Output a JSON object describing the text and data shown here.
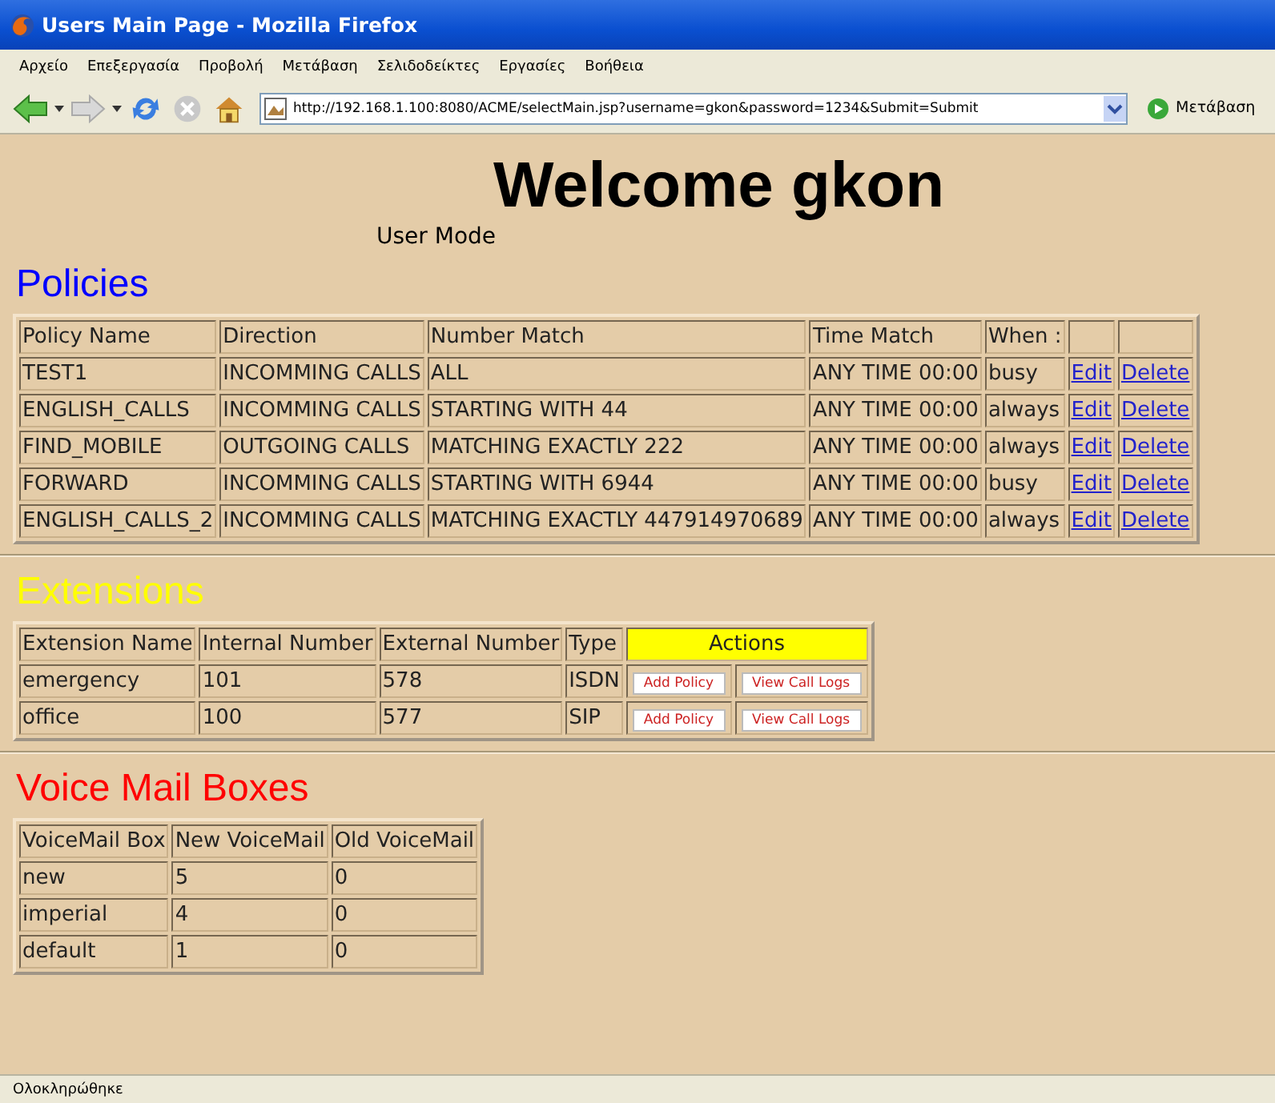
{
  "window": {
    "title": "Users Main Page - Mozilla Firefox"
  },
  "menu": [
    "Αρχείο",
    "Επεξεργασία",
    "Προβολή",
    "Μετάβαση",
    "Σελιδοδείκτες",
    "Εργασίες",
    "Βοήθεια"
  ],
  "toolbar": {
    "url": "http://192.168.1.100:8080/ACME/selectMain.jsp?username=gkon&password=1234&Submit=Submit",
    "go_button": "Μετάβαση"
  },
  "page": {
    "heading": "Welcome gkon",
    "mode": "User Mode"
  },
  "policies": {
    "title": "Policies",
    "color": "#0000ff",
    "columns": [
      "Policy Name",
      "Direction",
      "Number Match",
      "Time Match",
      "When :"
    ],
    "rows": [
      {
        "cells": [
          "TEST1",
          "INCOMMING CALLS",
          "ALL",
          "ANY TIME 00:00",
          "busy"
        ],
        "actions": [
          "Edit",
          "Delete"
        ]
      },
      {
        "cells": [
          "ENGLISH_CALLS",
          "INCOMMING CALLS",
          "STARTING WITH 44",
          "ANY TIME 00:00",
          "always"
        ],
        "actions": [
          "Edit",
          "Delete"
        ]
      },
      {
        "cells": [
          "FIND_MOBILE",
          "OUTGOING CALLS",
          "MATCHING EXACTLY 222",
          "ANY TIME 00:00",
          "always"
        ],
        "actions": [
          "Edit",
          "Delete"
        ]
      },
      {
        "cells": [
          "FORWARD",
          "INCOMMING CALLS",
          "STARTING WITH 6944",
          "ANY TIME 00:00",
          "busy"
        ],
        "actions": [
          "Edit",
          "Delete"
        ]
      },
      {
        "cells": [
          "ENGLISH_CALLS_2",
          "INCOMMING CALLS",
          "MATCHING EXACTLY 447914970689",
          "ANY TIME 00:00",
          "always"
        ],
        "actions": [
          "Edit",
          "Delete"
        ]
      }
    ]
  },
  "extensions": {
    "title": "Extensions",
    "color": "#ffff00",
    "columns": [
      "Extension Name",
      "Internal Number",
      "External Number",
      "Type"
    ],
    "actions_header": "Actions",
    "rows": [
      {
        "cells": [
          "emergency",
          "101",
          "578",
          "ISDN"
        ],
        "actions": [
          "Add Policy",
          "View Call Logs"
        ]
      },
      {
        "cells": [
          "office",
          "100",
          "577",
          "SIP"
        ],
        "actions": [
          "Add Policy",
          "View Call Logs"
        ]
      }
    ]
  },
  "voicemail": {
    "title": "Voice Mail Boxes",
    "color": "#ff0000",
    "columns": [
      "VoiceMail Box",
      "New VoiceMail",
      "Old VoiceMail"
    ],
    "rows": [
      {
        "cells": [
          "new",
          "5",
          "0"
        ]
      },
      {
        "cells": [
          "imperial",
          "4",
          "0"
        ]
      },
      {
        "cells": [
          "default",
          "1",
          "0"
        ]
      }
    ]
  },
  "status_bar": "Ολοκληρώθηκε"
}
